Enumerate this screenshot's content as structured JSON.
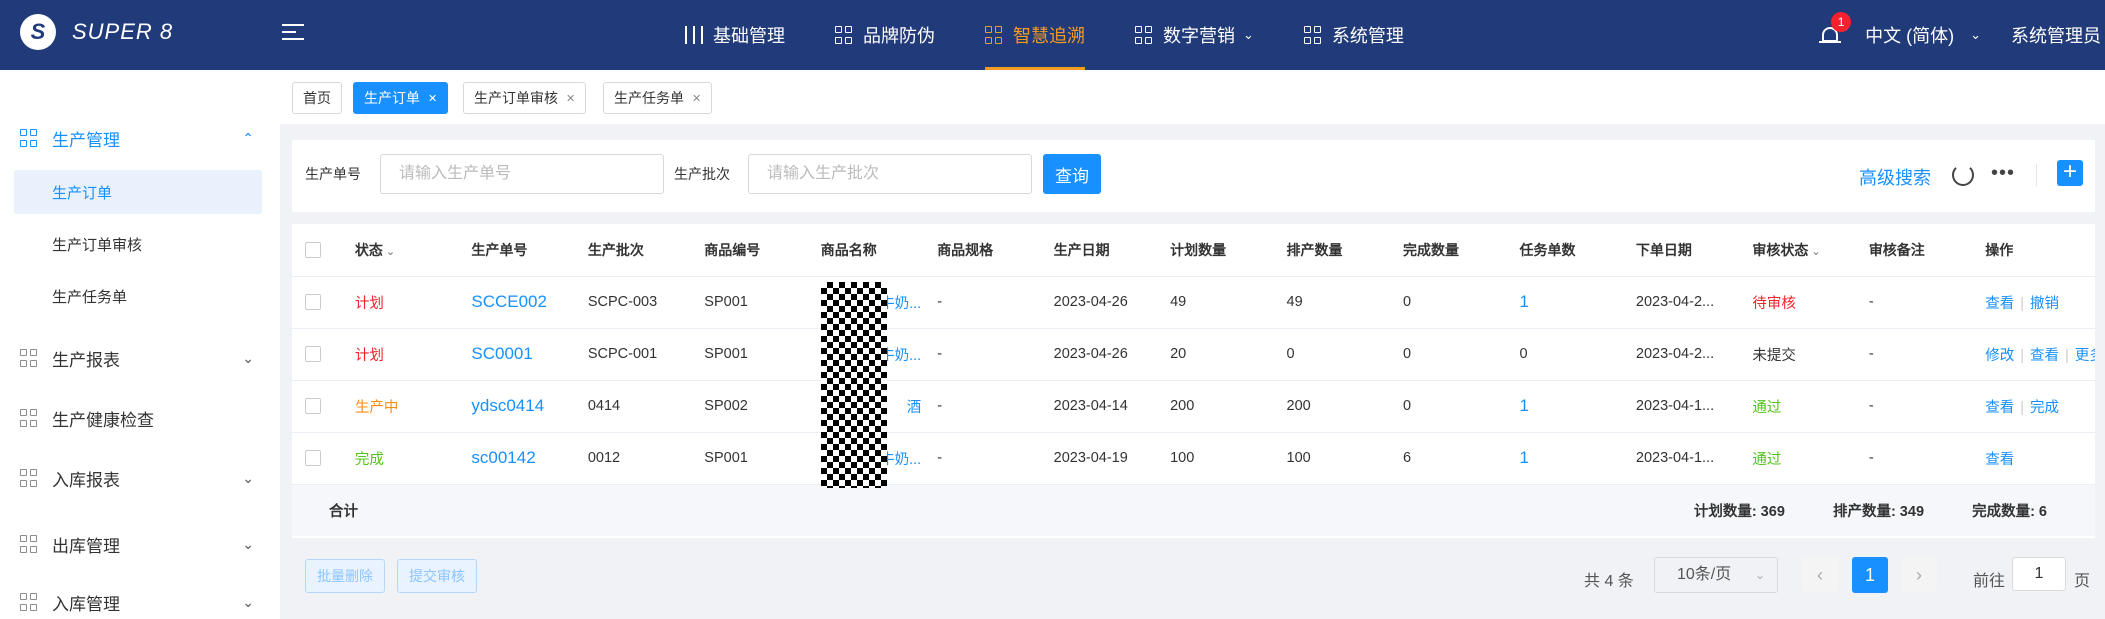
{
  "brand": {
    "logo_letter": "S",
    "name": "SUPER 8"
  },
  "topnav": [
    {
      "label": "基础管理",
      "icon": "sliders-icon"
    },
    {
      "label": "品牌防伪",
      "icon": "grid-icon"
    },
    {
      "label": "智慧追溯",
      "icon": "grid-icon",
      "active": true
    },
    {
      "label": "数字营销",
      "icon": "grid-icon",
      "dropdown": true
    },
    {
      "label": "系统管理",
      "icon": "grid-icon"
    }
  ],
  "header": {
    "notification_count": "1",
    "language": "中文 (简体)",
    "user": "系统管理员"
  },
  "sidebar": {
    "groups": [
      {
        "label": "生产管理",
        "open": true,
        "children": [
          "生产订单",
          "生产订单审核",
          "生产任务单"
        ]
      },
      {
        "label": "生产报表"
      },
      {
        "label": "生产健康检查"
      },
      {
        "label": "入库报表"
      },
      {
        "label": "出库管理"
      },
      {
        "label": "入库管理"
      }
    ]
  },
  "tabs": [
    {
      "label": "首页",
      "closable": false
    },
    {
      "label": "生产订单",
      "closable": true,
      "active": true
    },
    {
      "label": "生产订单审核",
      "closable": true
    },
    {
      "label": "生产任务单",
      "closable": true
    }
  ],
  "search": {
    "order_no_label": "生产单号",
    "order_no_placeholder": "请输入生产单号",
    "batch_label": "生产批次",
    "batch_placeholder": "请输入生产批次",
    "query_label": "查询",
    "advanced_label": "高级搜索",
    "add_label": "+"
  },
  "table": {
    "columns": [
      "状态",
      "生产单号",
      "生产批次",
      "商品编号",
      "商品名称",
      "商品规格",
      "生产日期",
      "计划数量",
      "排产数量",
      "完成数量",
      "任务单数",
      "下单日期",
      "审核状态",
      "审核备注",
      "操作"
    ],
    "rows": [
      {
        "status": "计划",
        "order_no": "SCCE002",
        "batch": "SCPC-003",
        "sku": "SP001",
        "name": "牛奶...",
        "spec": "-",
        "prod_date": "2023-04-26",
        "plan_qty": "49",
        "sched_qty": "49",
        "done_qty": "0",
        "tasks": "1",
        "order_date": "2023-04-2...",
        "audit": "待审核",
        "remark": "-",
        "ops": [
          "查看",
          "撤销"
        ]
      },
      {
        "status": "计划",
        "order_no": "SC0001",
        "batch": "SCPC-001",
        "sku": "SP001",
        "name": "牛奶...",
        "spec": "-",
        "prod_date": "2023-04-26",
        "plan_qty": "20",
        "sched_qty": "0",
        "done_qty": "0",
        "tasks": "0",
        "order_date": "2023-04-2...",
        "audit": "未提交",
        "remark": "-",
        "ops": [
          "修改",
          "查看",
          "更多"
        ]
      },
      {
        "status": "生产中",
        "order_no": "ydsc0414",
        "batch": "0414",
        "sku": "SP002",
        "name": "酒",
        "spec": "-",
        "prod_date": "2023-04-14",
        "plan_qty": "200",
        "sched_qty": "200",
        "done_qty": "0",
        "tasks": "1",
        "order_date": "2023-04-1...",
        "audit": "通过",
        "remark": "-",
        "ops": [
          "查看",
          "完成"
        ]
      },
      {
        "status": "完成",
        "order_no": "sc00142",
        "batch": "0012",
        "sku": "SP001",
        "name": "牛奶...",
        "spec": "-",
        "prod_date": "2023-04-19",
        "plan_qty": "100",
        "sched_qty": "100",
        "done_qty": "6",
        "tasks": "1",
        "order_date": "2023-04-1...",
        "audit": "通过",
        "remark": "-",
        "ops": [
          "查看"
        ]
      }
    ],
    "summary": {
      "label": "合计",
      "plan": "计划数量: 369",
      "sched": "排产数量: 349",
      "done": "完成数量: 6"
    }
  },
  "footer": {
    "batch_delete": "批量删除",
    "submit_audit": "提交审核",
    "total": "共 4 条",
    "page_size": "10条/页",
    "current_page": "1",
    "goto_label": "前往",
    "goto_value": "1",
    "goto_suffix": "页"
  },
  "colors": {
    "header_bg": "#213a7a",
    "accent": "#1890ff",
    "active_nav": "#f59a23"
  }
}
